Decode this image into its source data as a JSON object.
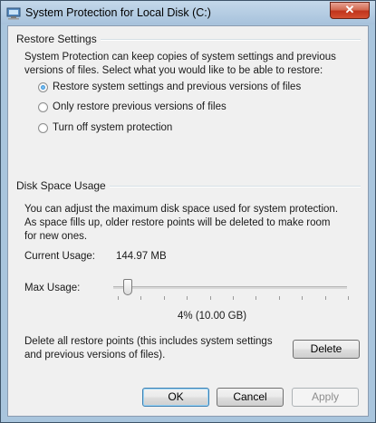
{
  "window": {
    "title": "System Protection for Local Disk (C:)",
    "close_glyph": "✕"
  },
  "restore_settings": {
    "header": "Restore Settings",
    "description": "System Protection can keep copies of system settings and previous versions of files. Select what you would like to be able to restore:",
    "options": [
      {
        "label": "Restore system settings and previous versions of files",
        "selected": true
      },
      {
        "label": "Only restore previous versions of files",
        "selected": false
      },
      {
        "label": "Turn off system protection",
        "selected": false
      }
    ]
  },
  "disk_space": {
    "header": "Disk Space Usage",
    "description": "You can adjust the maximum disk space used for system protection. As space fills up, older restore points will be deleted to make room for new ones.",
    "current_usage_label": "Current Usage:",
    "current_usage_value": "144.97 MB",
    "max_usage_label": "Max Usage:",
    "max_usage_value": "4% (10.00 GB)",
    "max_usage_fraction": 0.04,
    "delete_text": "Delete all restore points (this includes system settings and previous versions of files).",
    "delete_button": "Delete"
  },
  "buttons": {
    "ok": "OK",
    "cancel": "Cancel",
    "apply": "Apply"
  }
}
